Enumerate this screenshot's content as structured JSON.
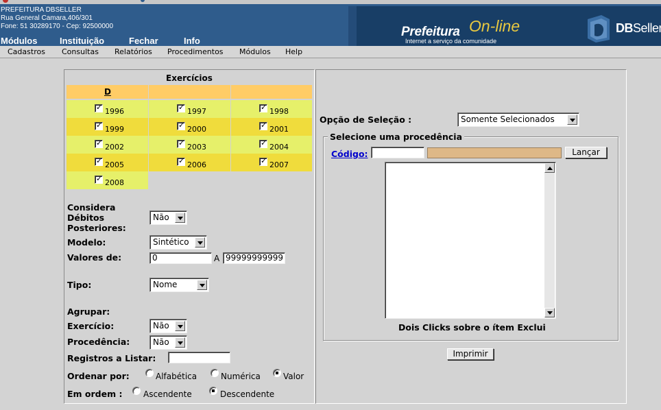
{
  "header": {
    "org_name": "PREFEITURA DBSELLER",
    "address": "Rua General Camara,406/301",
    "contact": "Fone: 51 30289170  -  Cep: 92500000",
    "logo_main": "Prefeitura",
    "logo_accent": "On-line",
    "logo_tagline": "Internet a serviço da comunidade",
    "vendor_bold": "DB",
    "vendor_regular": "Seller",
    "nav": [
      "Módulos",
      "Instituição",
      "Fechar",
      "Info"
    ]
  },
  "menubar": [
    "Cadastros",
    "Consultas",
    "Relatórios",
    "Procedimentos",
    "Módulos",
    "Help"
  ],
  "exercicios": {
    "title": "Exercícios",
    "header_link": "D",
    "years": [
      {
        "label": "1996",
        "checked": true
      },
      {
        "label": "1997",
        "checked": true
      },
      {
        "label": "1998",
        "checked": true
      },
      {
        "label": "1999",
        "checked": true
      },
      {
        "label": "2000",
        "checked": true
      },
      {
        "label": "2001",
        "checked": true
      },
      {
        "label": "2002",
        "checked": true
      },
      {
        "label": "2003",
        "checked": true
      },
      {
        "label": "2004",
        "checked": true
      },
      {
        "label": "2005",
        "checked": true
      },
      {
        "label": "2006",
        "checked": true
      },
      {
        "label": "2007",
        "checked": true
      },
      {
        "label": "2008",
        "checked": true
      }
    ],
    "colors": {
      "header": "#ffcc66",
      "light": "#e6f06a",
      "dark": "#f0dc3c"
    }
  },
  "form": {
    "considera_label_1": "Considera",
    "considera_label_2": "Débitos",
    "considera_label_3": "Posteriores:",
    "considera_value": "Não",
    "modelo_label": "Modelo:",
    "modelo_value": "Sintético",
    "valores_label": "Valores de:",
    "valores_from": "0",
    "valores_sep": "A",
    "valores_to": "99999999999",
    "tipo_label": "Tipo:",
    "tipo_value": "Nome",
    "agrupar_label": "Agrupar:",
    "exercicio_label": "Exercício:",
    "exercicio_value": "Não",
    "procedencia_label": "Procedência:",
    "procedencia_value": "Não",
    "registros_label": "Registros a Listar:",
    "registros_value": "",
    "ordenar_label": "Ordenar por:",
    "ordenar_options": [
      "Alfabética",
      "Numérica",
      "Valor"
    ],
    "ordenar_selected": "Valor",
    "ordem_label": "Em ordem :",
    "ordem_options": [
      "Ascendente",
      "Descendente"
    ],
    "ordem_selected": "Descendente"
  },
  "right": {
    "opcao_label": "Opção de Seleção :",
    "opcao_value": "Somente Selecionados",
    "fieldset_legend": "Selecione uma procedência",
    "codigo_label": "Código:",
    "codigo_value": "",
    "lancar_label": "Lançar",
    "hint": "Dois Clicks sobre o ítem Exclui",
    "imprimir_label": "Imprimir"
  }
}
